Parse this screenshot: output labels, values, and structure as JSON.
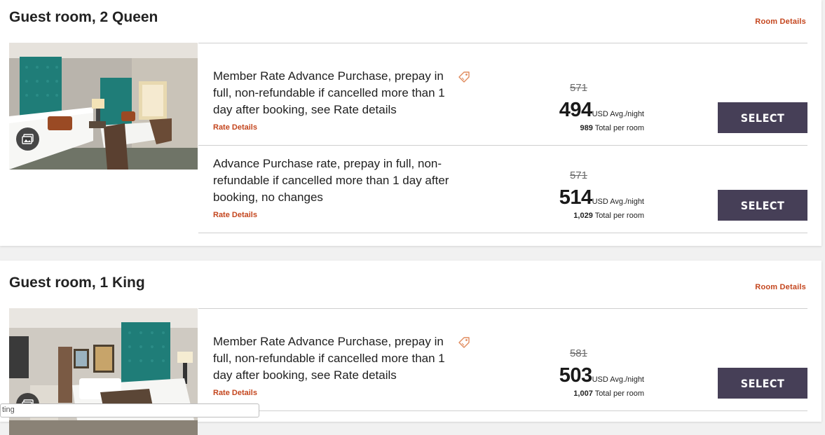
{
  "rooms": [
    {
      "title": "Guest room, 2 Queen",
      "room_details_label": "Room Details",
      "rates": [
        {
          "description": "Member Rate Advance Purchase, prepay in full, non-refundable if cancelled more than 1 day after booking, see Rate details",
          "rate_details_label": "Rate Details",
          "has_tag_icon": true,
          "original_price": "571",
          "price": "494",
          "price_unit": "USD Avg./night",
          "total_value": "989",
          "total_label": "Total per room",
          "select_label": "SELECT"
        },
        {
          "description": "Advance Purchase rate, prepay in full, non-refundable if cancelled more than 1 day after booking, no changes",
          "rate_details_label": "Rate Details",
          "has_tag_icon": false,
          "original_price": "571",
          "price": "514",
          "price_unit": "USD Avg./night",
          "total_value": "1,029",
          "total_label": "Total per room",
          "select_label": "SELECT"
        }
      ]
    },
    {
      "title": "Guest room, 1 King",
      "room_details_label": "Room Details",
      "rates": [
        {
          "description": "Member Rate Advance Purchase, prepay in full, non-refundable if cancelled more than 1 day after booking, see Rate details",
          "rate_details_label": "Rate Details",
          "has_tag_icon": true,
          "original_price": "581",
          "price": "503",
          "price_unit": "USD Avg./night",
          "total_value": "1,007",
          "total_label": "Total per room",
          "select_label": "SELECT"
        }
      ]
    }
  ],
  "tooltip_fragment": "ting",
  "colors": {
    "accent": "#c4461e",
    "button": "#463f57",
    "headboard": "#1f7d78"
  }
}
